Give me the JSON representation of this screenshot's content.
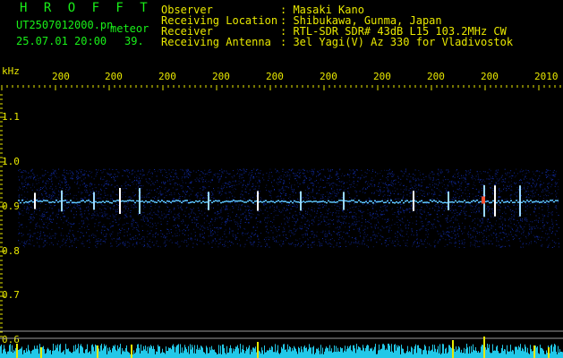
{
  "logo": "H R O F F T",
  "file": {
    "name": "UT2507012000.pn",
    "tag": "meteor",
    "datetime": "25.07.01 20:00",
    "count": "39."
  },
  "header": {
    "labels": [
      "Observer",
      "Receiving Location",
      "Receiver",
      "Receiving Antenna"
    ],
    "values": [
      ": Masaki Kano",
      ": Shibukawa, Gunma, Japan",
      ": RTL-SDR SDR# 43dB L15 103.2MHz CW",
      ": 3el Yagi(V) Az 330 for Vladivostok"
    ]
  },
  "axis": {
    "y_unit": "kHz",
    "y_ticks": [
      "1.1",
      "1.0",
      "0.9",
      "0.8",
      "0.7",
      "0.6"
    ],
    "y_values": [
      1.1,
      1.0,
      0.9,
      0.8,
      0.7,
      0.6
    ],
    "x_ticks": [
      "200",
      "200",
      "200",
      "200",
      "200",
      "200",
      "200",
      "200",
      "200",
      "2010"
    ]
  },
  "colors": {
    "text_green": "#19f019",
    "text_yellow": "#e8e800",
    "background": "#000000",
    "signal_band": "#2a45c8",
    "echo_line": "#5fc8ff",
    "baseline_trace": "#22c8e8"
  }
}
